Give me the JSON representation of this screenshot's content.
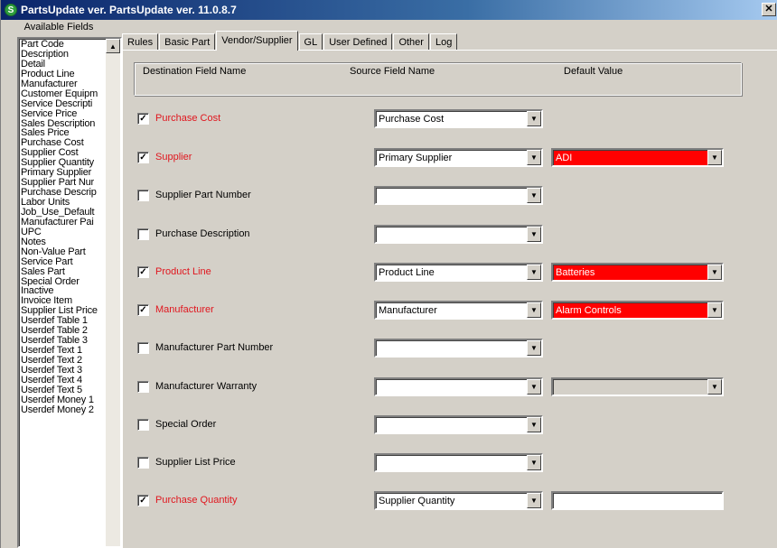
{
  "window": {
    "title": "PartsUpdate ver. PartsUpdate ver. 11.0.8.7",
    "app_icon": "S",
    "close_glyph": "✕"
  },
  "available_fields": {
    "label": "Available Fields",
    "items": [
      "Part Code",
      "Description",
      "Detail",
      "Product Line",
      "Manufacturer",
      "Customer Equipm",
      "Service Descripti",
      "Service Price",
      "Sales Description",
      "Sales Price",
      "Purchase Cost",
      "Supplier Cost",
      "Supplier Quantity",
      "Primary Supplier",
      "Supplier Part Nur",
      "Purchase Descrip",
      "Labor Units",
      "Job_Use_Default",
      "Manufacturer Pai",
      "UPC",
      "Notes",
      "Non-Value Part",
      "Service Part",
      "Sales Part",
      "Special Order",
      "Inactive",
      "Invoice Item",
      "Supplier List Price",
      "Userdef Table 1",
      "Userdef Table 2",
      "Userdef Table 3",
      "Userdef Text 1",
      "Userdef Text 2",
      "Userdef Text 3",
      "Userdef Text 4",
      "Userdef Text 5",
      "Userdef Money 1",
      "Userdef Money 2"
    ]
  },
  "tabs": [
    {
      "label": "Rules",
      "active": false
    },
    {
      "label": "Basic Part",
      "active": false
    },
    {
      "label": "Vendor/Supplier",
      "active": true
    },
    {
      "label": "GL",
      "active": false
    },
    {
      "label": "User Defined",
      "active": false
    },
    {
      "label": "Other",
      "active": false
    },
    {
      "label": "Log",
      "active": false
    }
  ],
  "headers": {
    "destination": "Destination Field Name",
    "source": "Source Field Name",
    "default": "Default Value"
  },
  "colors": {
    "active_field": "#e0161e",
    "default_highlight": "#ff0000"
  },
  "rows": [
    {
      "label": "Purchase Cost",
      "checked": true,
      "source": "Purchase Cost",
      "default": null,
      "default_style": "none"
    },
    {
      "label": "Supplier",
      "checked": true,
      "source": "Primary Supplier",
      "default": "ADI",
      "default_style": "red-dropdown"
    },
    {
      "label": "Supplier Part Number",
      "checked": false,
      "source": "",
      "default": null,
      "default_style": "none"
    },
    {
      "label": "Purchase Description",
      "checked": false,
      "source": "",
      "default": null,
      "default_style": "none"
    },
    {
      "label": "Product Line",
      "checked": true,
      "source": "Product Line",
      "default": "Batteries",
      "default_style": "red-dropdown"
    },
    {
      "label": "Manufacturer",
      "checked": true,
      "source": "Manufacturer",
      "default": "Alarm Controls",
      "default_style": "red-dropdown"
    },
    {
      "label": "Manufacturer Part Number",
      "checked": false,
      "source": "",
      "default": null,
      "default_style": "none"
    },
    {
      "label": "Manufacturer Warranty",
      "checked": false,
      "source": "",
      "default": "",
      "default_style": "grey-dropdown"
    },
    {
      "label": "Special Order",
      "checked": false,
      "source": "",
      "default": null,
      "default_style": "none"
    },
    {
      "label": "Supplier List Price",
      "checked": false,
      "source": "",
      "default": null,
      "default_style": "none"
    },
    {
      "label": "Purchase Quantity",
      "checked": true,
      "source": "Supplier Quantity",
      "default": "",
      "default_style": "white-text"
    }
  ]
}
